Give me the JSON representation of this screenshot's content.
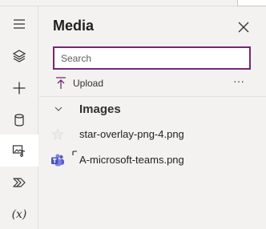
{
  "panel": {
    "title": "Media",
    "search_placeholder": "Search",
    "upload_label": "Upload",
    "more_label": "···"
  },
  "rail": {
    "items": [
      "menu",
      "layers",
      "insert",
      "data",
      "media",
      "power-automate",
      "variables"
    ],
    "active": "media",
    "variables_label": "(x)"
  },
  "library": {
    "group_label": "Images",
    "files": [
      {
        "name": "star-overlay-png-4.png"
      },
      {
        "name": "A-microsoft-teams.png"
      }
    ]
  },
  "colors": {
    "accent": "#742774",
    "teams": "#5b5fc7"
  }
}
